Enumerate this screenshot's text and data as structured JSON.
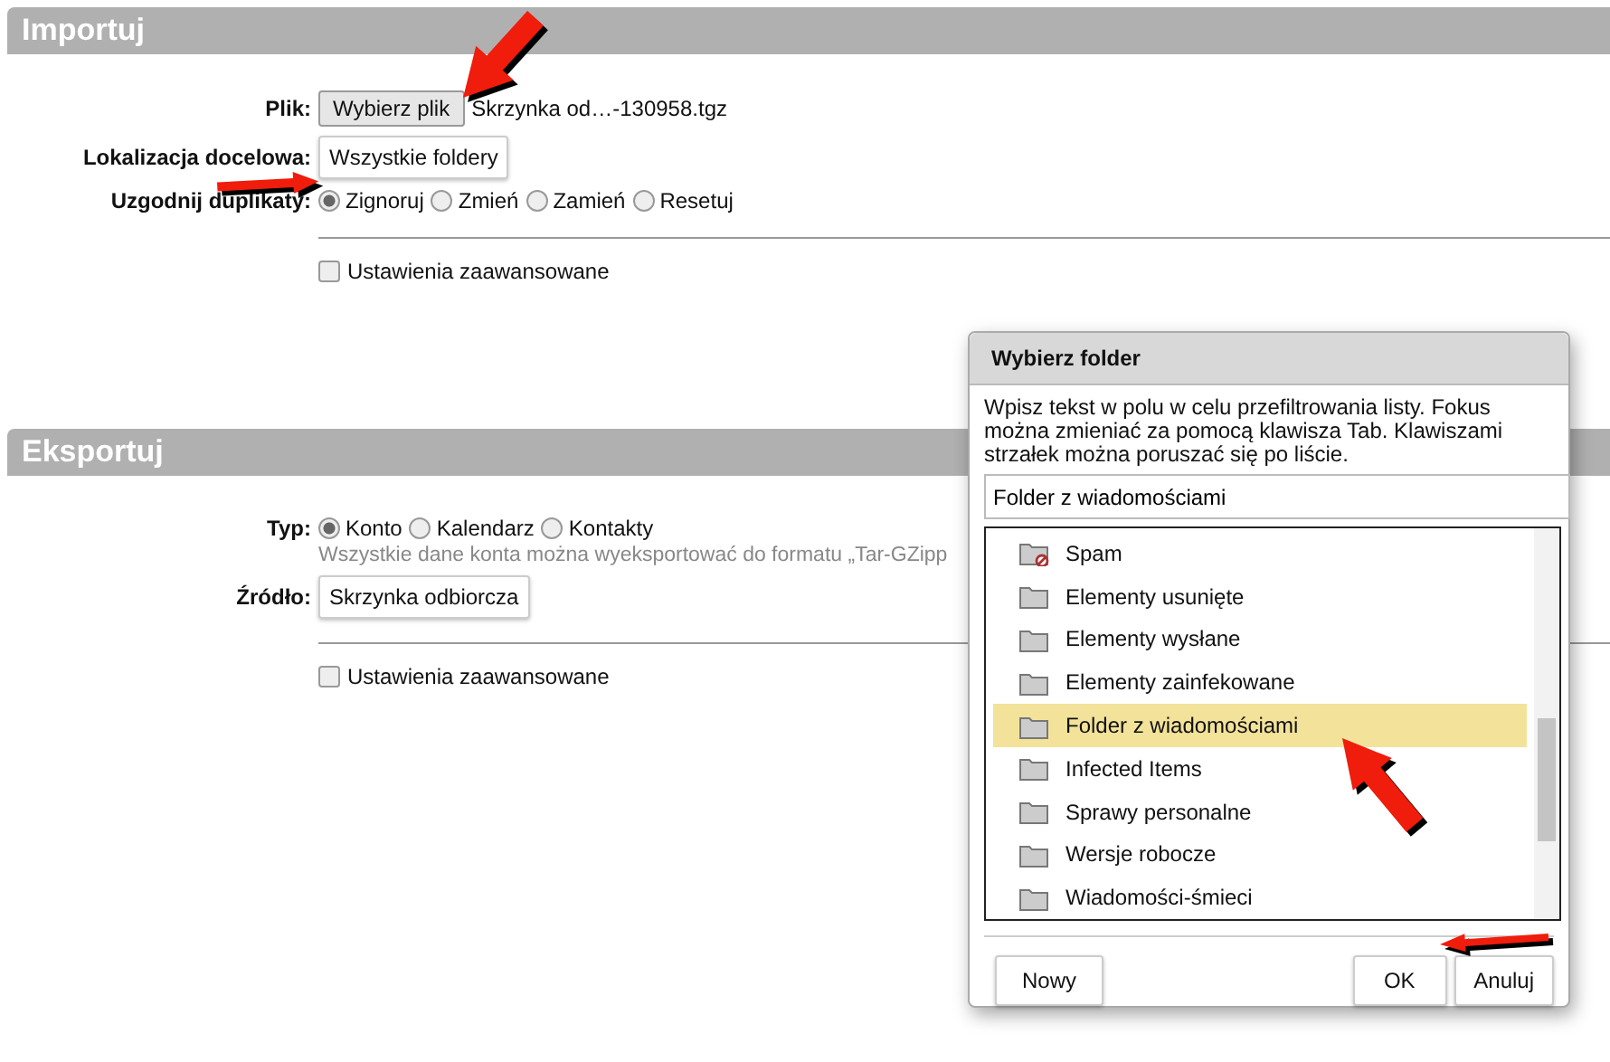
{
  "import": {
    "title": "Importuj",
    "file": {
      "label": "Plik:",
      "button": "Wybierz plik",
      "filename": "Skrzynka od…-130958.tgz"
    },
    "target": {
      "label": "Lokalizacja docelowa:",
      "button": "Wszystkie foldery"
    },
    "duplicates": {
      "label": "Uzgodnij duplikaty:",
      "options": [
        {
          "label": "Zignoruj",
          "selected": true
        },
        {
          "label": "Zmień",
          "selected": false
        },
        {
          "label": "Zamień",
          "selected": false
        },
        {
          "label": "Resetuj",
          "selected": false
        }
      ]
    },
    "advanced": {
      "label": "Ustawienia zaawansowane",
      "checked": false
    }
  },
  "export": {
    "title": "Eksportuj",
    "type": {
      "label": "Typ:",
      "options": [
        {
          "label": "Konto",
          "selected": true
        },
        {
          "label": "Kalendarz",
          "selected": false
        },
        {
          "label": "Kontakty",
          "selected": false
        }
      ]
    },
    "hint": "Wszystkie dane konta można wyeksportować do formatu „Tar-GZipp",
    "source": {
      "label": "Źródło:",
      "button": "Skrzynka odbiorcza"
    },
    "advanced": {
      "label": "Ustawienia zaawansowane",
      "checked": false
    }
  },
  "dialog": {
    "title": "Wybierz folder",
    "instructions": "Wpisz tekst w polu w celu przefiltrowania listy. Fokus można zmieniać za pomocą klawisza Tab. Klawiszami strzałek można poruszać się po liście.",
    "filter": {
      "value": "Folder z wiadomościami"
    },
    "folders": [
      {
        "label": "Spam",
        "kind": "spam",
        "selected": false
      },
      {
        "label": "Elementy usunięte",
        "kind": "folder",
        "selected": false
      },
      {
        "label": "Elementy wysłane",
        "kind": "folder",
        "selected": false
      },
      {
        "label": "Elementy zainfekowane",
        "kind": "folder",
        "selected": false
      },
      {
        "label": "Folder z wiadomościami",
        "kind": "folder",
        "selected": true
      },
      {
        "label": "Infected Items",
        "kind": "folder",
        "selected": false
      },
      {
        "label": "Sprawy personalne",
        "kind": "folder",
        "selected": false
      },
      {
        "label": "Wersje robocze",
        "kind": "folder",
        "selected": false
      },
      {
        "label": "Wiadomości-śmieci",
        "kind": "folder",
        "selected": false
      }
    ],
    "buttons": [
      {
        "label": "Nowy",
        "kind": "left"
      },
      {
        "label": "OK",
        "kind": "right"
      },
      {
        "label": "Anuluj",
        "kind": "right"
      }
    ]
  }
}
